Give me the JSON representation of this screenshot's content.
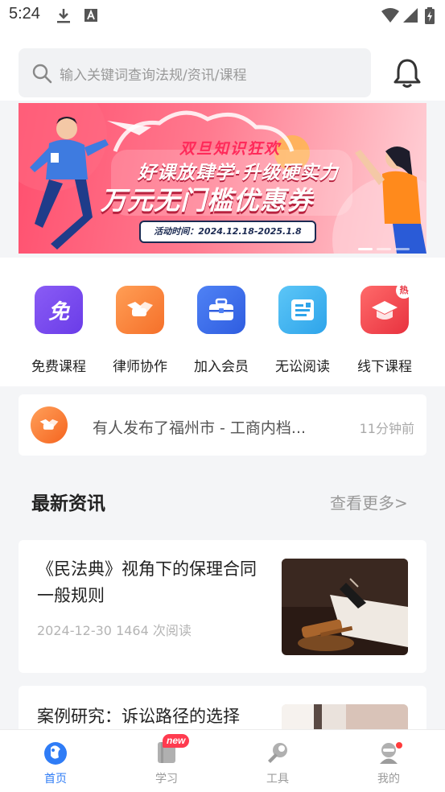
{
  "status_bar": {
    "time": "5:24"
  },
  "search": {
    "placeholder": "输入关键词查询法规/资讯/课程"
  },
  "banner": {
    "line1": "双旦知识狂欢",
    "line2": "好课放肆学·升级硬实力",
    "line3": "万元无门槛优惠券",
    "date_label": "活动时间：2024.12.18-2025.1.8",
    "slide_count": 3,
    "active_slide": 1
  },
  "quick_entries": [
    {
      "label": "免费课程",
      "icon": "free-badge-icon",
      "glyph": "免",
      "color": "#7a4bf0"
    },
    {
      "label": "律师协作",
      "icon": "handshake-icon",
      "color": "#ff8a3d"
    },
    {
      "label": "加入会员",
      "icon": "briefcase-icon",
      "color": "#3f6ff0"
    },
    {
      "label": "无讼阅读",
      "icon": "reading-card-icon",
      "color": "#3aaeef"
    },
    {
      "label": "线下课程",
      "icon": "graduation-cap-icon",
      "color": "#f0454f",
      "badge": "热"
    }
  ],
  "notice": {
    "text": "有人发布了福州市 - 工商内档...",
    "time": "11分钟前"
  },
  "news": {
    "title": "最新资讯",
    "more": "查看更多>",
    "articles": [
      {
        "title": "《民法典》视角下的保理合同一般规则",
        "meta": "2024-12-30 1464 次阅读"
      },
      {
        "title": "案例研究：诉讼路径的选择"
      }
    ]
  },
  "tabbar": [
    {
      "label": "首页",
      "icon": "home-icon",
      "active": true
    },
    {
      "label": "学习",
      "icon": "study-book-icon",
      "badge": "new"
    },
    {
      "label": "工具",
      "icon": "wrench-icon"
    },
    {
      "label": "我的",
      "icon": "profile-icon",
      "dot": true
    }
  ],
  "colors": {
    "accent": "#2f7cf6",
    "banner_pink": "#ff4f6e",
    "badge_red": "#ff3b4f"
  }
}
